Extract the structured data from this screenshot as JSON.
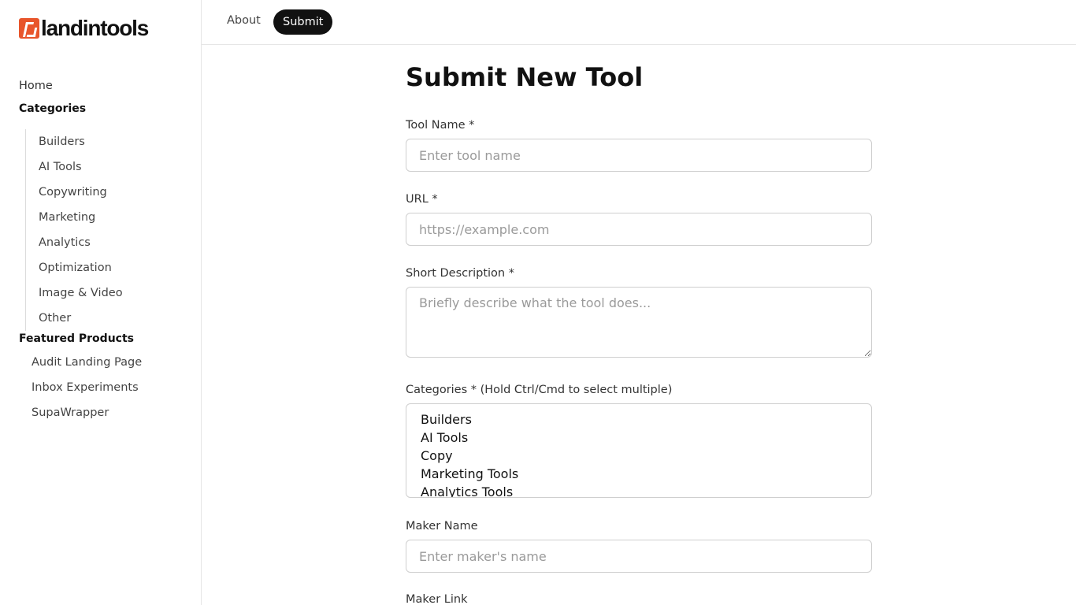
{
  "brand": {
    "name": "landintools",
    "accent": "#e8552b"
  },
  "topnav": {
    "about": "About",
    "submit": "Submit"
  },
  "sidebar": {
    "home": "Home",
    "categories_heading": "Categories",
    "categories": [
      "Builders",
      "AI Tools",
      "Copywriting",
      "Marketing",
      "Analytics",
      "Optimization",
      "Image & Video",
      "Other"
    ],
    "featured_heading": "Featured Products",
    "featured": [
      "Audit Landing Page",
      "Inbox Experiments",
      "SupaWrapper"
    ]
  },
  "form": {
    "title": "Submit New Tool",
    "tool_name": {
      "label": "Tool Name *",
      "placeholder": "Enter tool name"
    },
    "url": {
      "label": "URL *",
      "placeholder": "https://example.com"
    },
    "description": {
      "label": "Short Description *",
      "placeholder": "Briefly describe what the tool does..."
    },
    "categories": {
      "label": "Categories * (Hold Ctrl/Cmd to select multiple)",
      "options": [
        "Builders",
        "AI Tools",
        "Copy",
        "Marketing Tools",
        "Analytics Tools"
      ]
    },
    "maker_name": {
      "label": "Maker Name",
      "placeholder": "Enter maker's name"
    },
    "maker_link": {
      "label": "Maker Link"
    }
  }
}
